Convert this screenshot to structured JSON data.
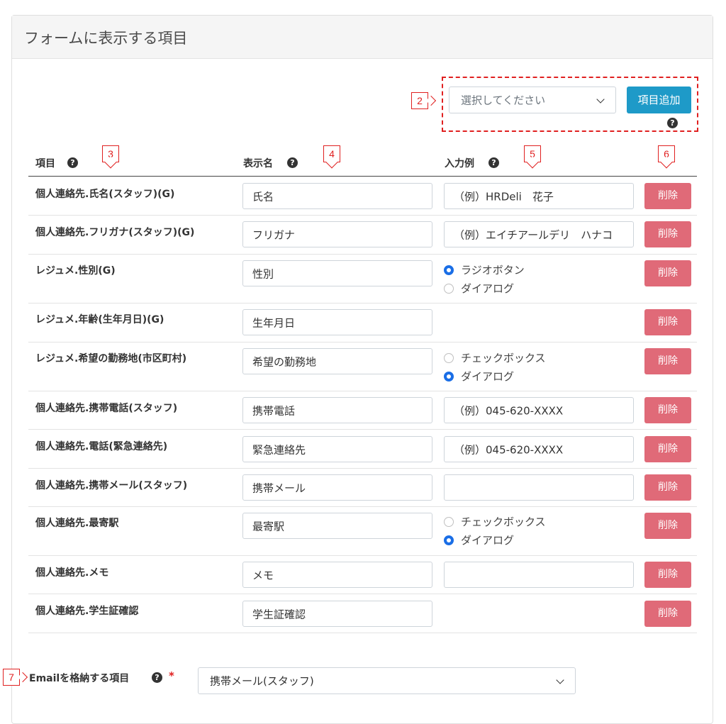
{
  "card": {
    "title": "フォームに表示する項目"
  },
  "add": {
    "select_placeholder": "選択してください",
    "add_button": "項目追加"
  },
  "columns": {
    "item": "項目",
    "display": "表示名",
    "example": "入力例"
  },
  "callouts": {
    "c2": "2",
    "c3": "3",
    "c4": "4",
    "c5": "5",
    "c6": "6",
    "c7": "7"
  },
  "delete_label": "削除",
  "rows": [
    {
      "item": "個人連絡先.氏名(スタッフ)(G)",
      "display": "氏名",
      "example": "（例）HRDeli　花子"
    },
    {
      "item": "個人連絡先.フリガナ(スタッフ)(G)",
      "display": "フリガナ",
      "example": "（例）エイチアールデリ　ハナコ"
    },
    {
      "item": "レジュメ.性別(G)",
      "display": "性別",
      "opt1": "ラジオボタン",
      "opt2": "ダイアログ"
    },
    {
      "item": "レジュメ.年齢(生年月日)(G)",
      "display": "生年月日"
    },
    {
      "item": "レジュメ.希望の勤務地(市区町村)",
      "display": "希望の勤務地",
      "opt1": "チェックボックス",
      "opt2": "ダイアログ"
    },
    {
      "item": "個人連絡先.携帯電話(スタッフ)",
      "display": "携帯電話",
      "example": "（例）045-620-XXXX"
    },
    {
      "item": "個人連絡先.電話(緊急連絡先)",
      "display": "緊急連絡先",
      "example": "（例）045-620-XXXX"
    },
    {
      "item": "個人連絡先.携帯メール(スタッフ)",
      "display": "携帯メール",
      "example": ""
    },
    {
      "item": "個人連絡先.最寄駅",
      "display": "最寄駅",
      "opt1": "チェックボックス",
      "opt2": "ダイアログ"
    },
    {
      "item": "個人連絡先.メモ",
      "display": "メモ",
      "example": ""
    },
    {
      "item": "個人連絡先.学生証確認",
      "display": "学生証確認"
    }
  ],
  "email": {
    "label": "Emailを格納する項目",
    "required_mark": "*",
    "selected": "携帯メール(スタッフ)"
  },
  "icons": {
    "help": "question-circle-icon",
    "chevron": "chevron-down-icon"
  },
  "colors": {
    "primary": "#1e9ac8",
    "danger": "#e06a78",
    "callout": "#e02020",
    "radio": "#1a6ee6"
  }
}
